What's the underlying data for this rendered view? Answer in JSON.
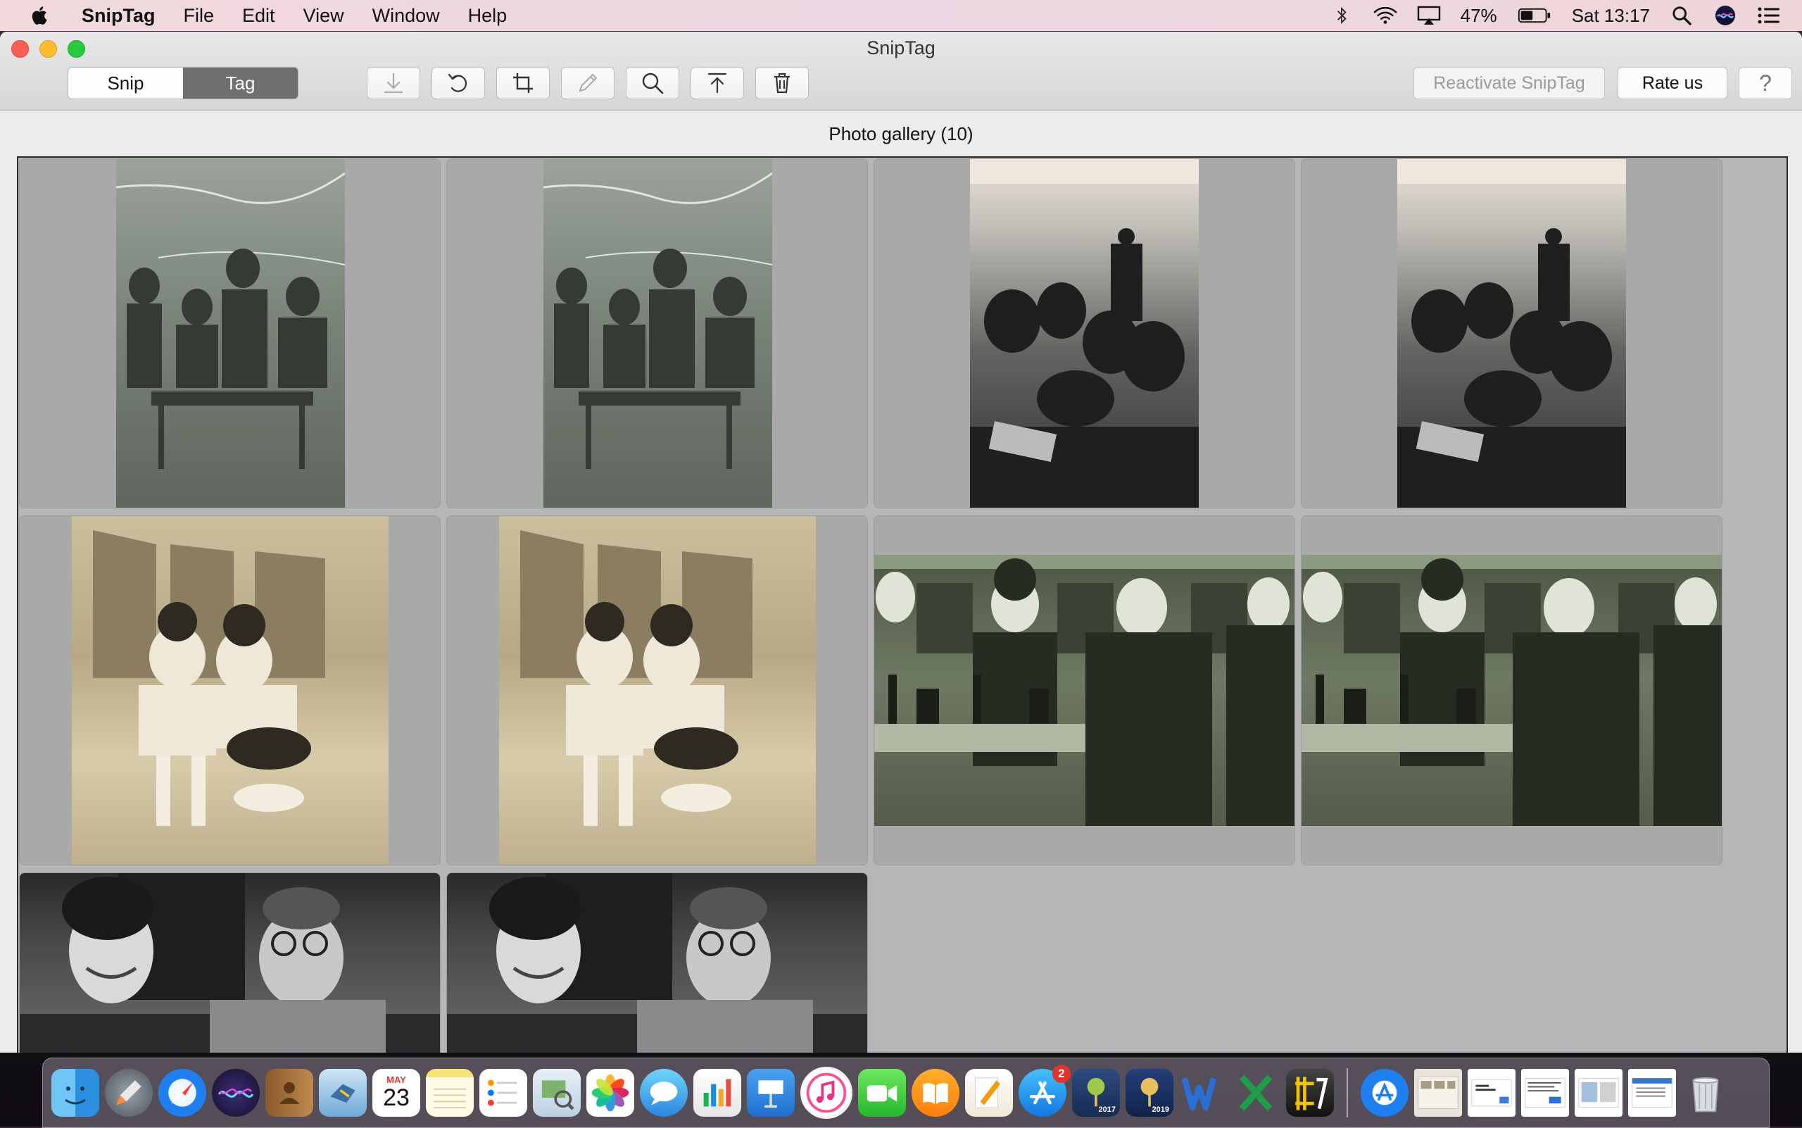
{
  "menubar": {
    "app_name": "SnipTag",
    "menus": [
      "File",
      "Edit",
      "View",
      "Window",
      "Help"
    ],
    "battery_percent": "47%",
    "clock": "Sat 13:17"
  },
  "window": {
    "title": "SnipTag",
    "mode_tabs": {
      "snip": "Snip",
      "tag": "Tag",
      "selected": "Tag"
    },
    "toolbar_icons": [
      "download-icon",
      "rotate-icon",
      "crop-icon",
      "pencil-icon",
      "magnifier-icon",
      "upload-icon",
      "trash-icon"
    ],
    "reactivate_label": "Reactivate SnipTag",
    "rate_label": "Rate us",
    "help_label": "?"
  },
  "gallery": {
    "title": "Photo gallery (10)",
    "photos": [
      {
        "subject": "children-portrait",
        "tone": "green-grey"
      },
      {
        "subject": "children-portrait",
        "tone": "green-grey"
      },
      {
        "subject": "beach-group",
        "tone": "black-white"
      },
      {
        "subject": "beach-group",
        "tone": "black-white"
      },
      {
        "subject": "two-women-beach",
        "tone": "sepia"
      },
      {
        "subject": "two-women-beach",
        "tone": "sepia"
      },
      {
        "subject": "pub-group",
        "tone": "green-grey"
      },
      {
        "subject": "pub-group",
        "tone": "green-grey"
      },
      {
        "subject": "two-women-portrait",
        "tone": "black-white"
      },
      {
        "subject": "two-women-portrait",
        "tone": "black-white"
      }
    ]
  },
  "dock": {
    "calendar_month": "MAY",
    "calendar_day": "23",
    "app_store_badge": "2",
    "family_tree_2017": "2017",
    "family_tree_2019": "2019"
  },
  "colors": {
    "tab_selected": "#6f6f6f",
    "gallery_bg": "#b6b6b6",
    "cell_bg": "#a9a9a9"
  }
}
